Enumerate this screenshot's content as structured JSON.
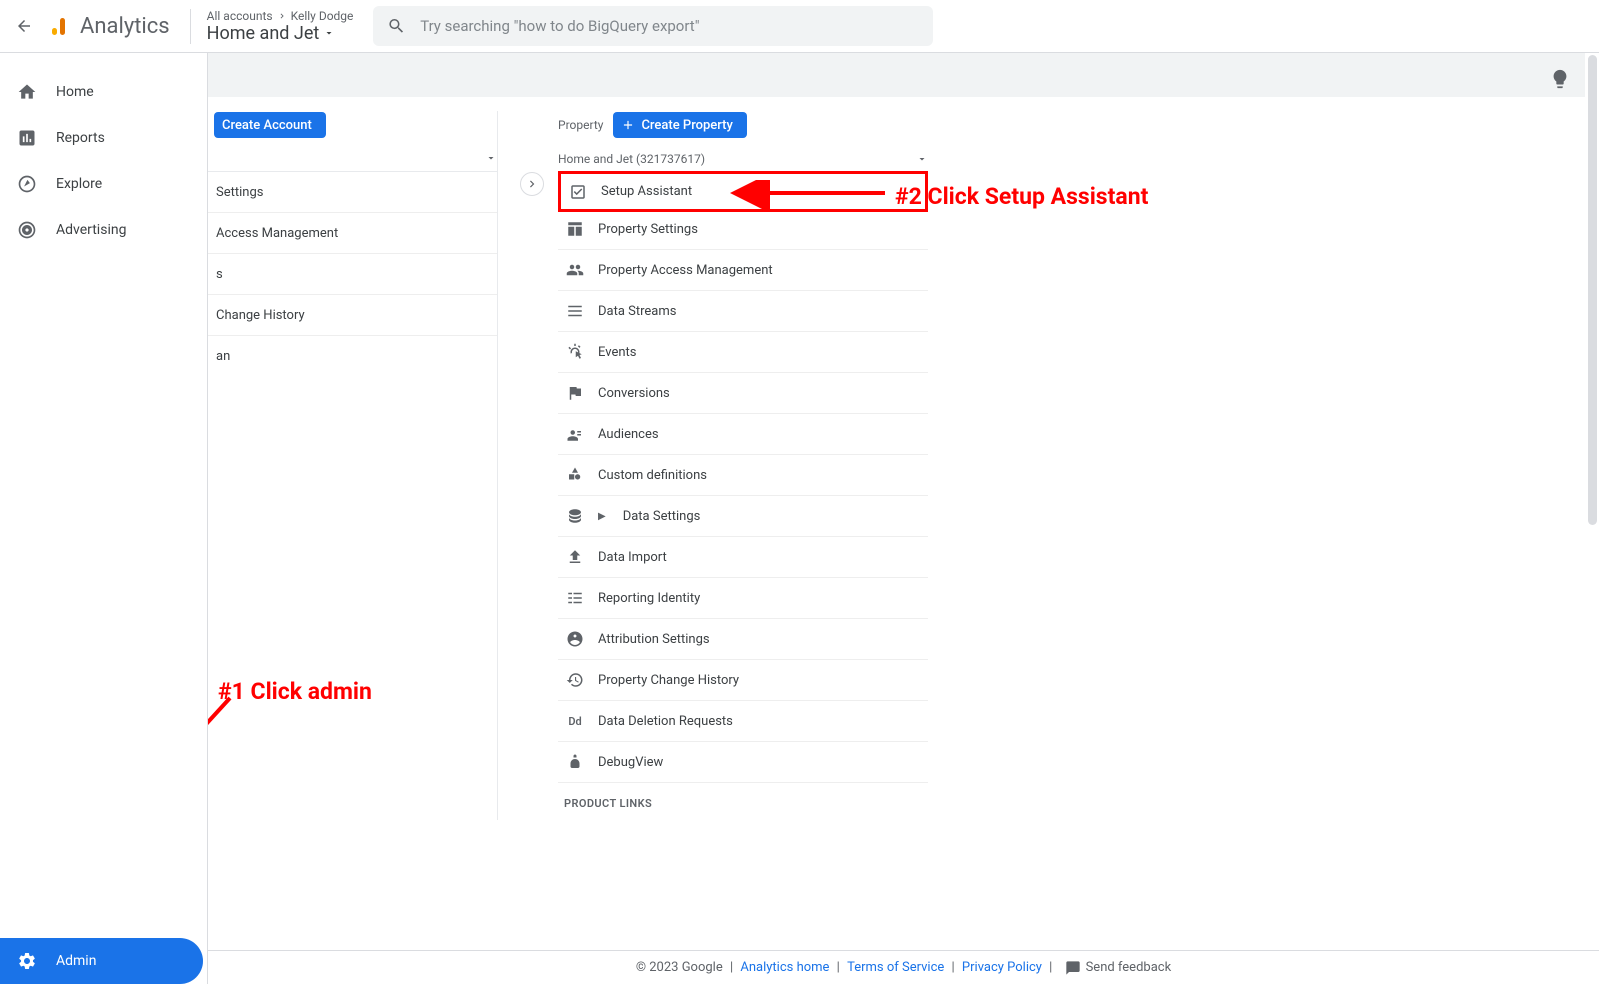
{
  "header": {
    "product_name": "Analytics",
    "breadcrumb_top_prefix": "All accounts",
    "breadcrumb_top_account": "Kelly Dodge",
    "breadcrumb_bottom": "Home and Jet",
    "search_placeholder": "Try searching \"how to do BigQuery export\""
  },
  "sidebar": {
    "items": [
      {
        "label": "Home"
      },
      {
        "label": "Reports"
      },
      {
        "label": "Explore"
      },
      {
        "label": "Advertising"
      }
    ],
    "admin_label": "Admin"
  },
  "account_col": {
    "create_btn_label": "Create Account",
    "items": [
      {
        "label": "Settings"
      },
      {
        "label": "Access Management"
      },
      {
        "label": "s"
      },
      {
        "label": "Change History"
      },
      {
        "label": "an"
      }
    ]
  },
  "property_col": {
    "title": "Property",
    "create_btn_label": "Create Property",
    "selector_label": "Home and Jet (321737617)",
    "items": [
      {
        "label": "Setup Assistant",
        "highlight": true
      },
      {
        "label": "Property Settings"
      },
      {
        "label": "Property Access Management"
      },
      {
        "label": "Data Streams"
      },
      {
        "label": "Events"
      },
      {
        "label": "Conversions"
      },
      {
        "label": "Audiences"
      },
      {
        "label": "Custom definitions"
      },
      {
        "label": "Data Settings",
        "expandable": true
      },
      {
        "label": "Data Import"
      },
      {
        "label": "Reporting Identity"
      },
      {
        "label": "Attribution Settings"
      },
      {
        "label": "Property Change History"
      },
      {
        "label": "Data Deletion Requests"
      },
      {
        "label": "DebugView"
      }
    ],
    "section_heading": "PRODUCT LINKS"
  },
  "annotations": {
    "a1": "#1 Click admin",
    "a2": "#2 Click Setup Assistant"
  },
  "footer": {
    "copyright": "© 2023 Google",
    "links": [
      {
        "label": "Analytics home"
      },
      {
        "label": "Terms of Service"
      },
      {
        "label": "Privacy Policy"
      }
    ],
    "feedback_label": "Send feedback"
  }
}
